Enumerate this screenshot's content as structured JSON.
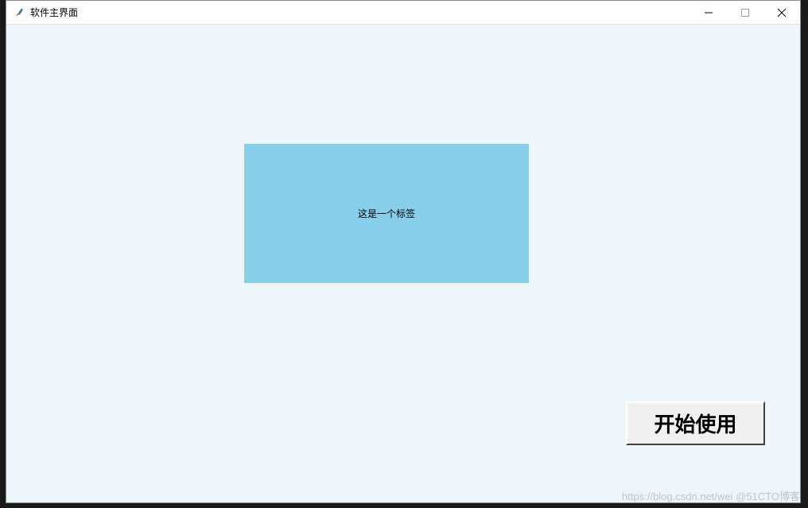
{
  "window": {
    "title": "软件主界面"
  },
  "label": {
    "text": "这是一个标签"
  },
  "button": {
    "start_label": "开始使用"
  },
  "watermark": {
    "text": "https://blog.csdn.net/wei @51CTO博客"
  }
}
